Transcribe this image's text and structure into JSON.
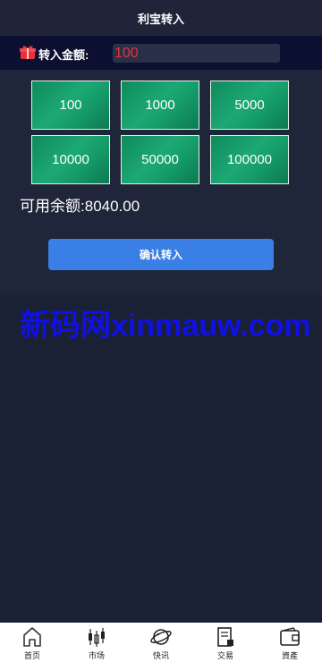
{
  "header": {
    "title": "利宝转入"
  },
  "amount": {
    "label": "转入金额:",
    "value": "100"
  },
  "presets": [
    "100",
    "1000",
    "5000",
    "10000",
    "50000",
    "100000"
  ],
  "balance": {
    "label": "可用余额:",
    "value": "8040.00"
  },
  "confirm": {
    "label": "确认转入"
  },
  "watermark": {
    "text": "新码网xinmauw.com"
  },
  "nav": [
    {
      "label": "首页",
      "icon": "home-icon"
    },
    {
      "label": "市场",
      "icon": "candlestick-icon"
    },
    {
      "label": "快讯",
      "icon": "planet-icon"
    },
    {
      "label": "交易",
      "icon": "receipt-icon"
    },
    {
      "label": "資產",
      "icon": "wallet-icon"
    }
  ],
  "colors": {
    "accent": "#3a7fe6",
    "preset_green": "#17a06c",
    "input_text": "#e8303a",
    "watermark": "#1010e8"
  }
}
